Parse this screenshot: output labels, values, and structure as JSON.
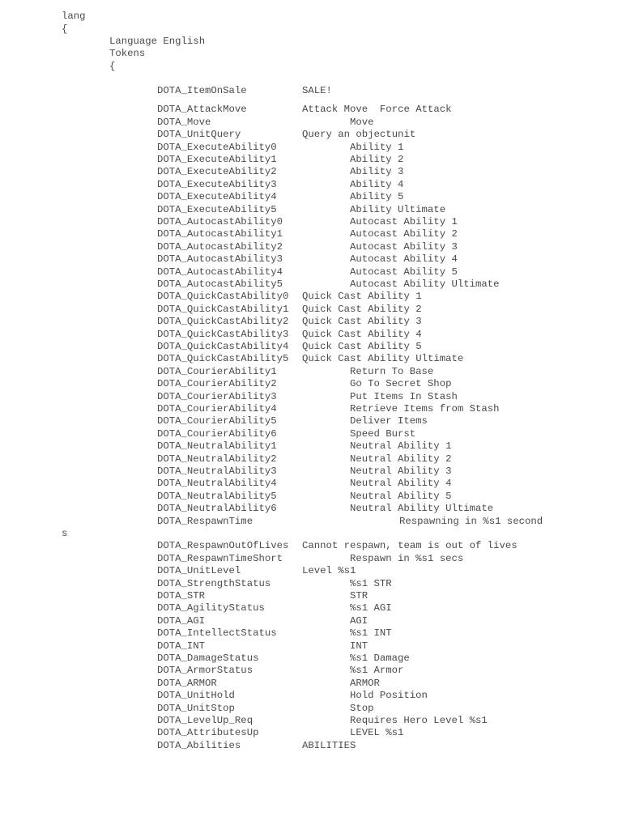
{
  "header": {
    "root": "lang",
    "open_brace": "{",
    "language_line": "Language English",
    "tokens_label": "Tokens",
    "tokens_brace": "{"
  },
  "tokens": [
    {
      "key": "DOTA_ItemOnSale",
      "value": "SALE!",
      "col": 1
    },
    {
      "key": "DOTA_AttackMove",
      "value": "Attack Move  Force Attack",
      "col": 1
    },
    {
      "key": "DOTA_Move",
      "value": "Move",
      "col": 2
    },
    {
      "key": "DOTA_UnitQuery",
      "value": "Query an objectunit",
      "col": 1
    },
    {
      "key": "DOTA_ExecuteAbility0",
      "value": "Ability 1",
      "col": 2
    },
    {
      "key": "DOTA_ExecuteAbility1",
      "value": "Ability 2",
      "col": 2
    },
    {
      "key": "DOTA_ExecuteAbility2",
      "value": "Ability 3",
      "col": 2
    },
    {
      "key": "DOTA_ExecuteAbility3",
      "value": "Ability 4",
      "col": 2
    },
    {
      "key": "DOTA_ExecuteAbility4",
      "value": "Ability 5",
      "col": 2
    },
    {
      "key": "DOTA_ExecuteAbility5",
      "value": "Ability Ultimate",
      "col": 2
    },
    {
      "key": "DOTA_AutocastAbility0",
      "value": "Autocast Ability 1",
      "col": 2
    },
    {
      "key": "DOTA_AutocastAbility1",
      "value": "Autocast Ability 2",
      "col": 2
    },
    {
      "key": "DOTA_AutocastAbility2",
      "value": "Autocast Ability 3",
      "col": 2
    },
    {
      "key": "DOTA_AutocastAbility3",
      "value": "Autocast Ability 4",
      "col": 2
    },
    {
      "key": "DOTA_AutocastAbility4",
      "value": "Autocast Ability 5",
      "col": 2
    },
    {
      "key": "DOTA_AutocastAbility5",
      "value": "Autocast Ability Ultimate",
      "col": 2
    },
    {
      "key": "DOTA_QuickCastAbility0",
      "value": "Quick Cast Ability 1",
      "col": 1
    },
    {
      "key": "DOTA_QuickCastAbility1",
      "value": "Quick Cast Ability 2",
      "col": 1
    },
    {
      "key": "DOTA_QuickCastAbility2",
      "value": "Quick Cast Ability 3",
      "col": 1
    },
    {
      "key": "DOTA_QuickCastAbility3",
      "value": "Quick Cast Ability 4",
      "col": 1
    },
    {
      "key": "DOTA_QuickCastAbility4",
      "value": "Quick Cast Ability 5",
      "col": 1
    },
    {
      "key": "DOTA_QuickCastAbility5",
      "value": "Quick Cast Ability Ultimate",
      "col": 1
    },
    {
      "key": "DOTA_CourierAbility1",
      "value": "Return To Base",
      "col": 2
    },
    {
      "key": "DOTA_CourierAbility2",
      "value": "Go To Secret Shop",
      "col": 2
    },
    {
      "key": "DOTA_CourierAbility3",
      "value": "Put Items In Stash",
      "col": 2
    },
    {
      "key": "DOTA_CourierAbility4",
      "value": "Retrieve Items from Stash",
      "col": 2
    },
    {
      "key": "DOTA_CourierAbility5",
      "value": "Deliver Items",
      "col": 2
    },
    {
      "key": "DOTA_CourierAbility6",
      "value": "Speed Burst",
      "col": 2
    },
    {
      "key": "DOTA_NeutralAbility1",
      "value": "Neutral Ability 1",
      "col": 2
    },
    {
      "key": "DOTA_NeutralAbility2",
      "value": "Neutral Ability 2",
      "col": 2
    },
    {
      "key": "DOTA_NeutralAbility3",
      "value": "Neutral Ability 3",
      "col": 2
    },
    {
      "key": "DOTA_NeutralAbility4",
      "value": "Neutral Ability 4",
      "col": 2
    },
    {
      "key": "DOTA_NeutralAbility5",
      "value": "Neutral Ability 5",
      "col": 2
    },
    {
      "key": "DOTA_NeutralAbility6",
      "value": "Neutral Ability Ultimate",
      "col": 2
    },
    {
      "key": "DOTA_RespawnTime",
      "value": "Respawning in %s1 second",
      "col": 3
    },
    {
      "key": "",
      "value": "s",
      "col": 0
    },
    {
      "key": "DOTA_RespawnOutOfLives",
      "value": "Cannot respawn, team is out of lives",
      "col": 1
    },
    {
      "key": "DOTA_RespawnTimeShort",
      "value": "Respawn in %s1 secs",
      "col": 2
    },
    {
      "key": "DOTA_UnitLevel",
      "value": "Level %s1",
      "col": 1
    },
    {
      "key": "DOTA_StrengthStatus",
      "value": "%s1 STR",
      "col": 2
    },
    {
      "key": "DOTA_STR",
      "value": "STR",
      "col": 2
    },
    {
      "key": "DOTA_AgilityStatus",
      "value": "%s1 AGI",
      "col": 2
    },
    {
      "key": "DOTA_AGI",
      "value": "AGI",
      "col": 2
    },
    {
      "key": "DOTA_IntellectStatus",
      "value": "%s1 INT",
      "col": 2
    },
    {
      "key": "DOTA_INT",
      "value": "INT",
      "col": 2
    },
    {
      "key": "DOTA_DamageStatus",
      "value": "%s1 Damage",
      "col": 2
    },
    {
      "key": "DOTA_ArmorStatus",
      "value": "%s1 Armor",
      "col": 2
    },
    {
      "key": "DOTA_ARMOR",
      "value": "ARMOR",
      "col": 2
    },
    {
      "key": "DOTA_UnitHold",
      "value": "Hold Position",
      "col": 2
    },
    {
      "key": "DOTA_UnitStop",
      "value": "Stop",
      "col": 2
    },
    {
      "key": "DOTA_LevelUp_Req",
      "value": "Requires Hero Level %s1",
      "col": 2
    },
    {
      "key": "DOTA_AttributesUp",
      "value": "LEVEL %s1",
      "col": 2
    },
    {
      "key": "DOTA_Abilities",
      "value": "ABILITIES",
      "col": 1
    }
  ]
}
